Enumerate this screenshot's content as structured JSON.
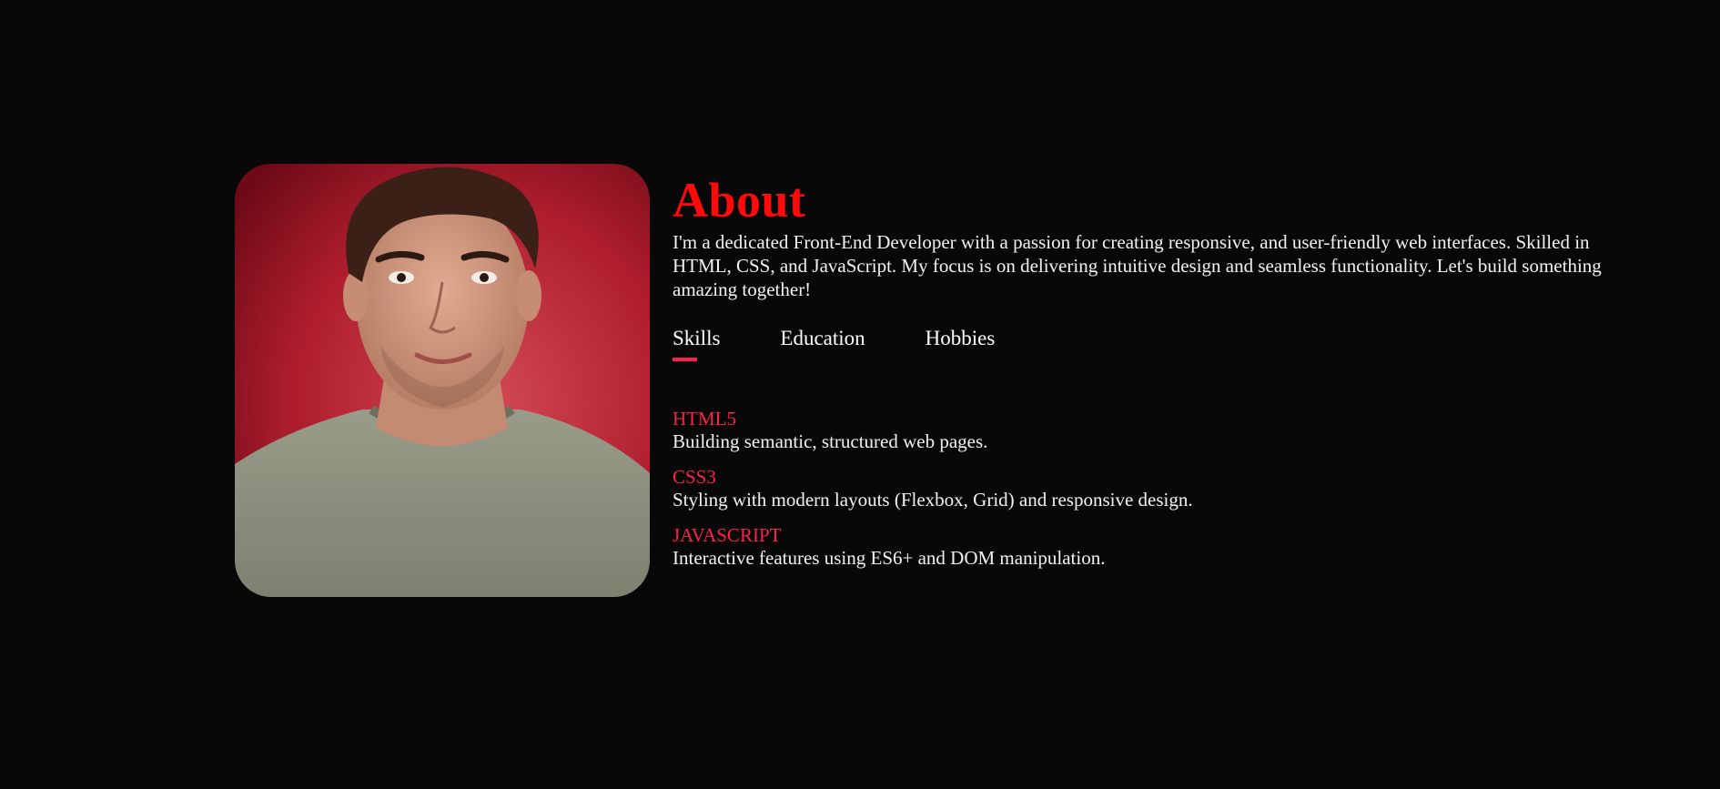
{
  "about": {
    "title": "About",
    "intro": "I'm a dedicated Front-End Developer with a passion for creating responsive, and user-friendly web interfaces. Skilled in HTML, CSS, and JavaScript. My focus is on delivering intuitive design and seamless functionality. Let's build something amazing together!"
  },
  "tabs": [
    {
      "label": "Skills"
    },
    {
      "label": "Education"
    },
    {
      "label": "Hobbies"
    }
  ],
  "skills": [
    {
      "name": "HTML5",
      "desc": "Building semantic, structured web pages."
    },
    {
      "name": "CSS3",
      "desc": "Styling with modern layouts (Flexbox, Grid) and responsive design."
    },
    {
      "name": "JAVASCRIPT",
      "desc": "Interactive features using ES6+ and DOM manipulation."
    }
  ],
  "colors": {
    "background": "#080808",
    "title": "#ff0a0a",
    "accent": "#ff1e4d",
    "text": "#f2f2f2"
  }
}
